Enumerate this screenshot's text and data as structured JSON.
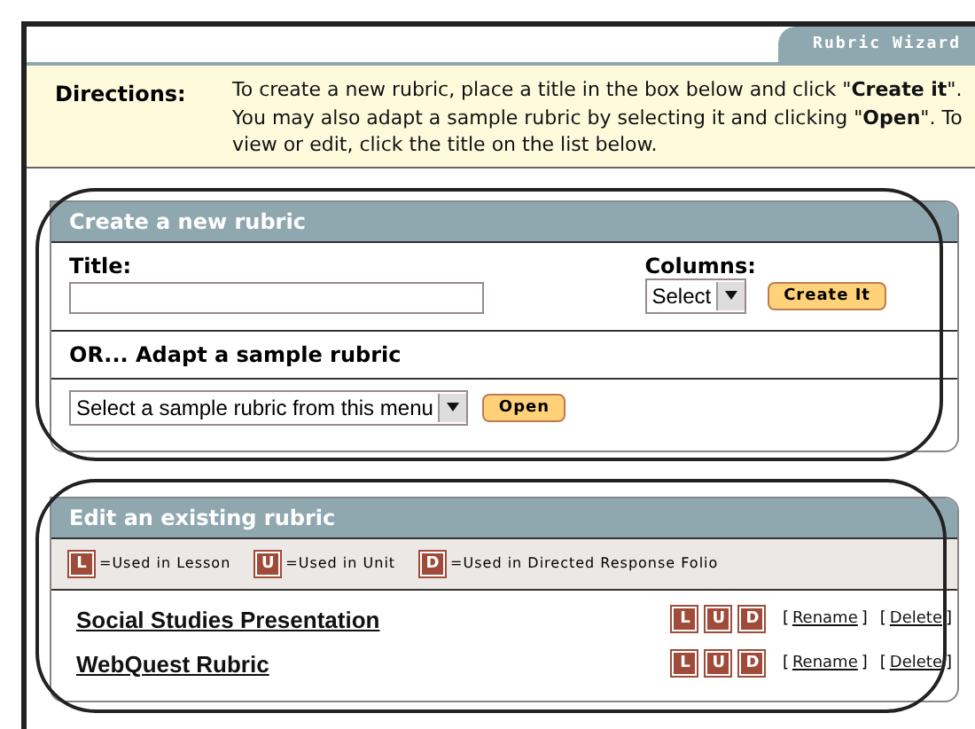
{
  "header_tab": "Rubric Wizard",
  "directions": {
    "label": "Directions:",
    "text": "To create a new rubric, place a title in the box below and click \"**Create it**\". You may also adapt a sample rubric by selecting it and clicking \"**Open**\". To view or edit, click the title on the list below."
  },
  "create_panel": {
    "title": "Create a new rubric",
    "title_label": "Title:",
    "columns_label": "Columns:",
    "columns_select": "Select",
    "create_button": "Create It",
    "adapt_heading": "OR... Adapt a sample rubric",
    "sample_select": "Select a sample rubric from this menu",
    "open_button": "Open"
  },
  "edit_panel": {
    "title": "Edit an existing rubric",
    "legend": [
      {
        "badge": "L",
        "label": "=Used in Lesson"
      },
      {
        "badge": "U",
        "label": "=Used in Unit"
      },
      {
        "badge": "D",
        "label": "=Used in Directed Response Folio"
      }
    ],
    "rubrics": [
      {
        "name": "Social Studies Presentation",
        "badges": [
          "L",
          "U",
          "D"
        ],
        "actions": [
          {
            "open": "[",
            "label": "Rename",
            "close": "]"
          },
          {
            "open": "[",
            "label": "Delete",
            "close": "]"
          }
        ]
      },
      {
        "name": "WebQuest Rubric",
        "badges": [
          "L",
          "U",
          "D"
        ],
        "actions": [
          {
            "open": "[",
            "label": "Rename",
            "close": "]"
          },
          {
            "open": "[",
            "label": "Delete",
            "close": "]"
          }
        ]
      }
    ]
  }
}
